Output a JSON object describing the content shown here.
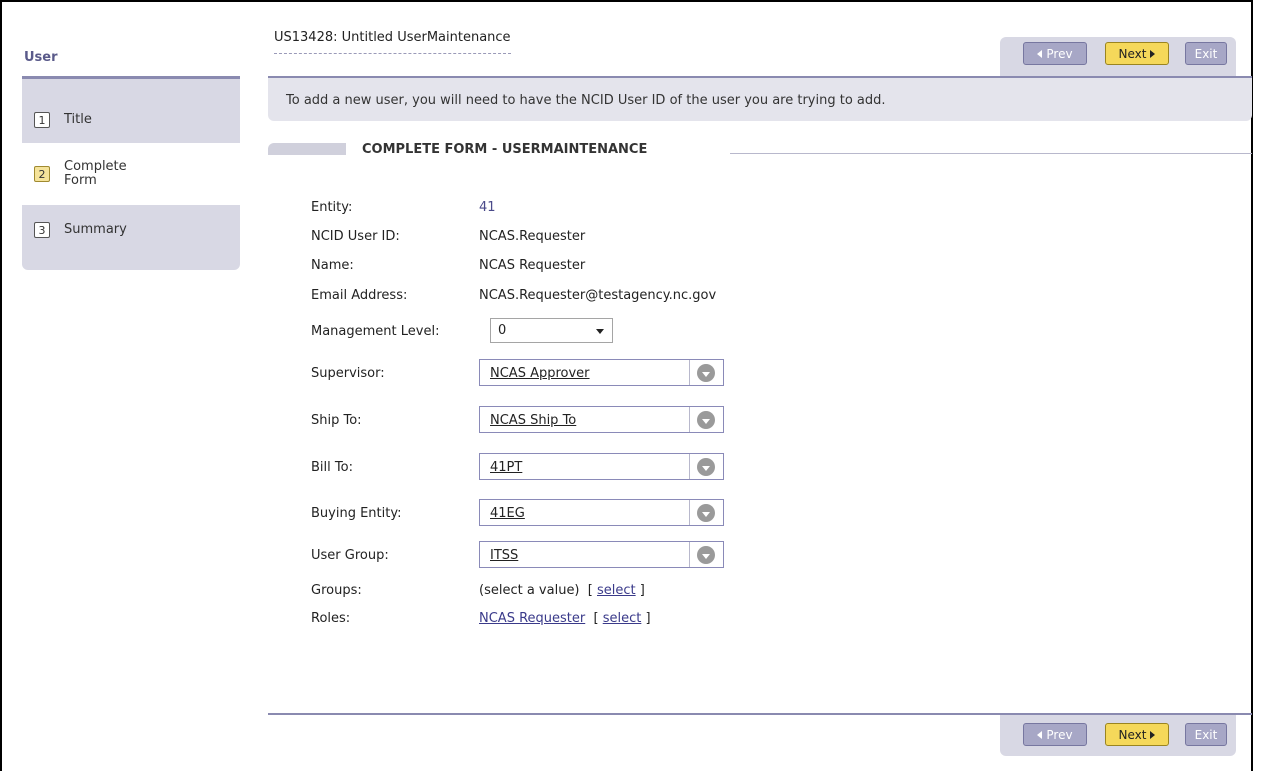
{
  "sidebar": {
    "title": "User",
    "steps": [
      {
        "num": "1",
        "label": "Title"
      },
      {
        "num": "2",
        "label_line1": "Complete",
        "label_line2": "Form"
      },
      {
        "num": "3",
        "label": "Summary"
      }
    ]
  },
  "header": {
    "title": "US13428: Untitled UserMaintenance",
    "prev_label": "Prev",
    "next_label": "Next",
    "exit_label": "Exit",
    "info": "To add a new user, you will need to have the NCID User ID of the user you are trying to add."
  },
  "section": {
    "title": "COMPLETE FORM - USERMAINTENANCE"
  },
  "form": {
    "entity": {
      "label": "Entity:",
      "value": "41"
    },
    "ncid": {
      "label": "NCID User ID:",
      "value": "NCAS.Requester"
    },
    "name": {
      "label": "Name:",
      "value": "NCAS Requester"
    },
    "email": {
      "label": "Email Address:",
      "value": "NCAS.Requester@testagency.nc.gov"
    },
    "management_level": {
      "label": "Management Level:",
      "value": "0"
    },
    "supervisor": {
      "label": "Supervisor:",
      "value": "NCAS Approver"
    },
    "ship_to": {
      "label": "Ship To:",
      "value": "NCAS Ship To"
    },
    "bill_to": {
      "label": "Bill To:",
      "value": "41PT"
    },
    "buying_entity": {
      "label": "Buying Entity:",
      "value": "41EG"
    },
    "user_group": {
      "label": "User Group:",
      "value": "ITSS"
    },
    "groups": {
      "label": "Groups:",
      "value": "(select a value)",
      "bracket_open": "[",
      "select_label": "select",
      "bracket_close": "]"
    },
    "roles": {
      "label": "Roles:",
      "value": "NCAS Requester",
      "bracket_open": "[",
      "select_label": "select",
      "bracket_close": "]"
    }
  },
  "footer": {
    "prev_label": "Prev",
    "next_label": "Next",
    "exit_label": "Exit"
  },
  "colors": {
    "accent": "#8a8ab0",
    "next_button": "#f5d85a",
    "panel": "#d8d8e4"
  }
}
